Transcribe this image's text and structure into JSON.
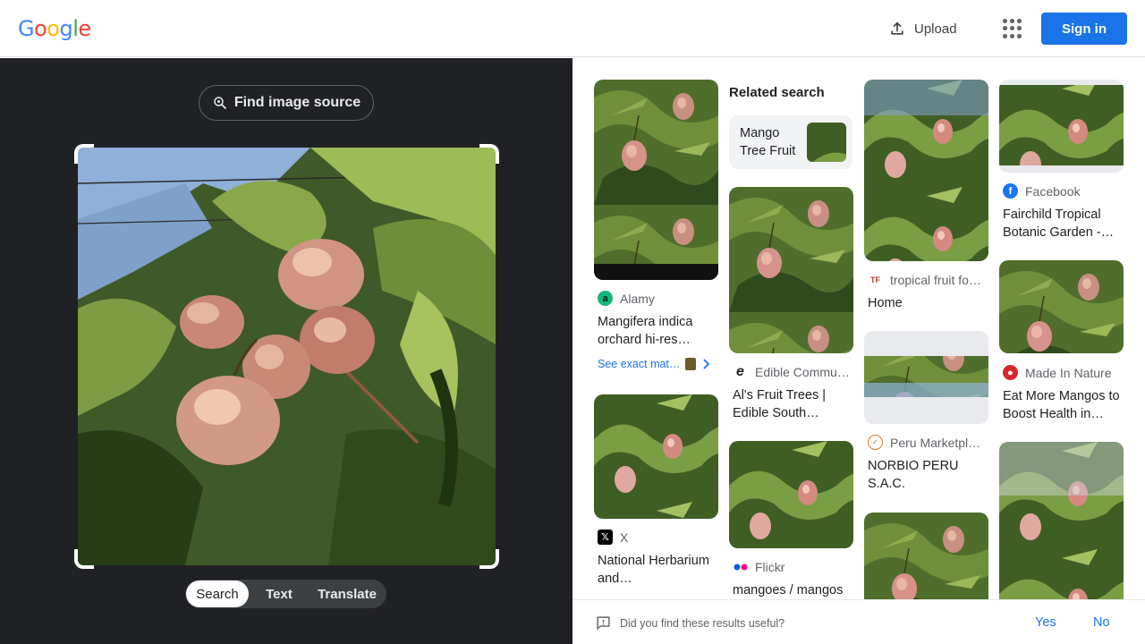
{
  "header": {
    "logo": {
      "letters": [
        "G",
        "o",
        "o",
        "g",
        "l",
        "e"
      ],
      "colors": [
        "#4285F4",
        "#EA4335",
        "#FBBC05",
        "#4285F4",
        "#34A853",
        "#EA4335"
      ]
    },
    "upload_label": "Upload",
    "signin_label": "Sign in"
  },
  "left": {
    "find_source_label": "Find image source",
    "tabs": [
      "Search",
      "Text",
      "Translate"
    ],
    "active_tab": "Search"
  },
  "right": {
    "related_heading": "Related search",
    "related_item": "Mango Tree Fruit",
    "results": [
      {
        "source": "Alamy",
        "title": "Mangifera indica orchard hi-res…",
        "icon": "alamy-icon"
      },
      {
        "source": "X",
        "title": "National Herbarium and…",
        "icon": "x-icon"
      },
      {
        "source": "Edible Commu…",
        "title": "Al's Fruit Trees | Edible South…",
        "icon": "edible-icon"
      },
      {
        "source": "Flickr",
        "title": "mangoes / mangos",
        "icon": "flickr-icon"
      },
      {
        "source": "tropical fruit fo…",
        "title": "Home",
        "icon": "tf-icon"
      },
      {
        "source": "Peru Marketpl…",
        "title": "NORBIO PERU S.A.C.",
        "icon": "peru-icon"
      },
      {
        "source": "Facebook",
        "title": "Fairchild Tropical Botanic Garden -…",
        "icon": "facebook-icon"
      },
      {
        "source": "Made In Nature",
        "title": "Eat More Mangos to Boost Health in…",
        "icon": "made-in-nature-icon"
      }
    ],
    "see_exact_label": "See exact mat…"
  },
  "feedback": {
    "question": "Did you find these results useful?",
    "yes": "Yes",
    "no": "No"
  }
}
